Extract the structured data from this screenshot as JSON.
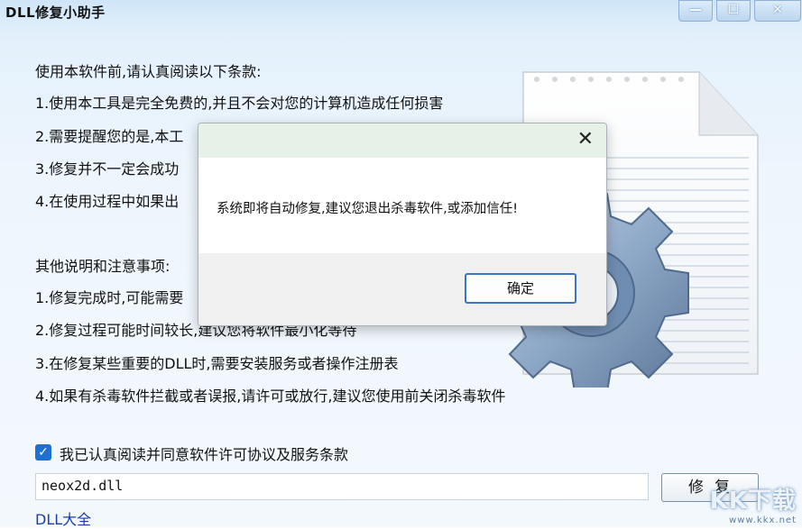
{
  "window": {
    "title": "DLL修复小助手",
    "minimize_glyph": "—",
    "maximize_glyph": "☐",
    "close_glyph": "✕"
  },
  "intro": {
    "heading": "使用本软件前,请认真阅读以下条款:",
    "items": [
      "1.使用本工具是完全免费的,并且不会对您的计算机造成任何损害",
      "2.需要提醒您的是,本工",
      "3.修复并不一定会成功",
      "4.在使用过程中如果出"
    ]
  },
  "notes": {
    "heading": "其他说明和注意事项:",
    "items": [
      "1.修复完成时,可能需要",
      "2.修复过程可能时间较长,建议您将软件最小化等待",
      "3.在修复某些重要的DLL时,需要安装服务或者操作注册表",
      "4.如果有杀毒软件拦截或者误报,请许可或放行,建议您使用前关闭杀毒软件"
    ]
  },
  "agree": {
    "checked": true,
    "label": "我已认真阅读并同意软件许可协议及服务条款"
  },
  "dll_input": {
    "value": "neox2d.dll"
  },
  "repair_button": "修复",
  "link": "DLL大全",
  "watermark": {
    "big": "KK下载",
    "small": "www.kkx.net"
  },
  "dialog": {
    "message": "系统即将自动修复,建议您退出杀毒软件,或添加信任!",
    "ok_label": "确定",
    "close_glyph": "✕"
  },
  "colors": {
    "accent": "#1f6fd2",
    "link": "#1a3ea8",
    "dialog_header": "#e6f2e8"
  }
}
